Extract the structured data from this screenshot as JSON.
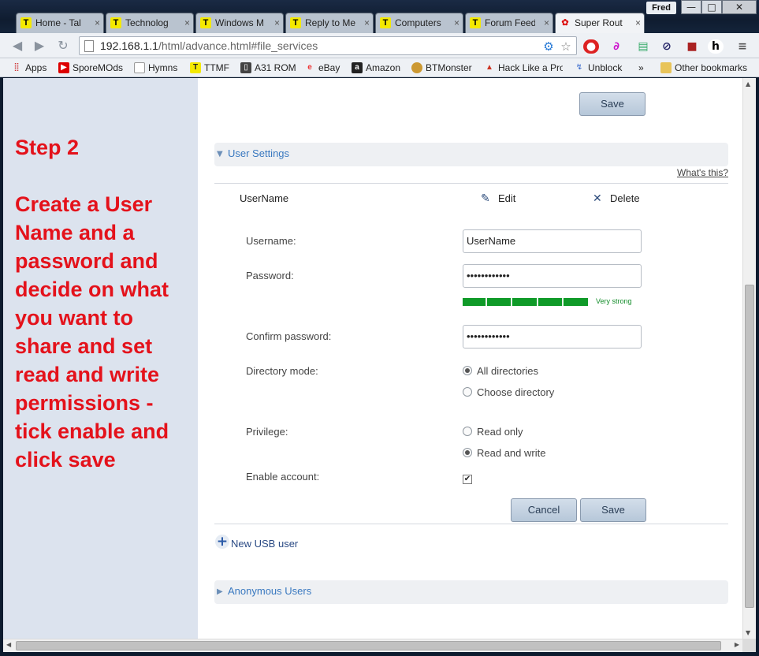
{
  "browser": {
    "profile_name": "Fred",
    "window_controls": {
      "minimize": "—",
      "maximize": "□",
      "close": "✕"
    },
    "tabs": [
      {
        "label": "Home - Tal",
        "favicon": "T"
      },
      {
        "label": "Technolog",
        "favicon": "T"
      },
      {
        "label": "Windows M",
        "favicon": "T"
      },
      {
        "label": "Reply to Me",
        "favicon": "T"
      },
      {
        "label": "Computers",
        "favicon": "T"
      },
      {
        "label": "Forum Feed",
        "favicon": "T"
      },
      {
        "label": "Super Rout",
        "favicon": "huawei-icon"
      }
    ],
    "tab_close": "×",
    "url_host": "192.168.1.1",
    "url_path": "/html/advance.html#file_services",
    "bookmarks": [
      {
        "label": "Apps",
        "icon": "apps-grid-icon"
      },
      {
        "label": "SporeMOds",
        "icon": "youtube-icon"
      },
      {
        "label": "Hymns",
        "icon": "page-icon"
      },
      {
        "label": "TTMF",
        "icon": "t-icon"
      },
      {
        "label": "A31 ROM",
        "icon": "phone-icon"
      },
      {
        "label": "eBay",
        "icon": "ebay-icon"
      },
      {
        "label": "Amazon",
        "icon": "amazon-icon"
      },
      {
        "label": "BTMonster",
        "icon": "monster-icon"
      },
      {
        "label": "Hack Like a Pro",
        "icon": "hack-icon"
      },
      {
        "label": "Unblock",
        "icon": "unblock-icon"
      }
    ],
    "bookmarks_overflow": "»",
    "other_bookmarks": "Other bookmarks",
    "extension_h": "h"
  },
  "instructions": {
    "title": "Step 2",
    "body": "Create a User Name and a password and decide on what you want to share and set read and write permissions - tick enable and click save"
  },
  "top_save_label": "Save",
  "user_settings": {
    "section_label": "User Settings",
    "help_link": "What's this?",
    "user_row_name": "UserName",
    "edit_label": "Edit",
    "delete_label": "Delete",
    "form": {
      "username_label": "Username:",
      "username_value": "UserName",
      "password_label": "Password:",
      "password_value": "••••••••••••",
      "strength_label": "Very strong",
      "strength_level": 1.0,
      "confirm_label": "Confirm password:",
      "confirm_value": "••••••••••••",
      "directory_label": "Directory mode:",
      "dir_all": "All directories",
      "dir_choose": "Choose directory",
      "directory_selected": "All directories",
      "privilege_label": "Privilege:",
      "priv_read": "Read only",
      "priv_write": "Read and write",
      "privilege_selected": "Read and write",
      "enable_label": "Enable account:",
      "enable_checked": true,
      "enable_mark": "✔",
      "cancel_label": "Cancel",
      "save_label": "Save"
    },
    "new_user_label": "New USB user",
    "new_user_plus": "+"
  },
  "anonymous_users": {
    "section_label": "Anonymous Users"
  }
}
